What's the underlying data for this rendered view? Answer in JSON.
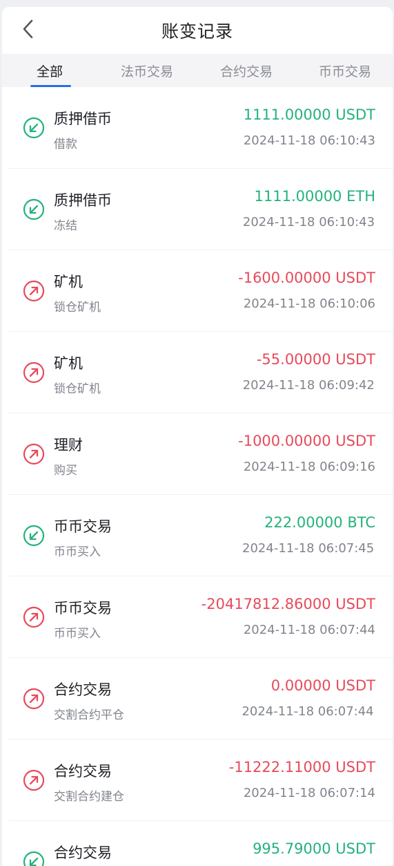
{
  "header": {
    "title": "账变记录",
    "back_icon": "chevron-left-icon"
  },
  "tabs": [
    {
      "label": "全部",
      "active": true
    },
    {
      "label": "法币交易",
      "active": false
    },
    {
      "label": "合约交易",
      "active": false
    },
    {
      "label": "币币交易",
      "active": false
    }
  ],
  "colors": {
    "positive": "#23b27b",
    "negative": "#e74a5b",
    "accent": "#2a6ee8"
  },
  "records": [
    {
      "title": "质押借币",
      "sub": "借款",
      "amount": "1111.00000 USDT",
      "time": "2024-11-18 06:10:43",
      "direction": "in",
      "icon": "arrow-down-left-icon"
    },
    {
      "title": "质押借币",
      "sub": "冻结",
      "amount": "1111.00000 ETH",
      "time": "2024-11-18 06:10:43",
      "direction": "in",
      "icon": "arrow-down-left-icon"
    },
    {
      "title": "矿机",
      "sub": "锁仓矿机",
      "amount": "-1600.00000 USDT",
      "time": "2024-11-18 06:10:06",
      "direction": "out",
      "icon": "arrow-up-right-icon"
    },
    {
      "title": "矿机",
      "sub": "锁仓矿机",
      "amount": "-55.00000 USDT",
      "time": "2024-11-18 06:09:42",
      "direction": "out",
      "icon": "arrow-up-right-icon"
    },
    {
      "title": "理财",
      "sub": "购买",
      "amount": "-1000.00000 USDT",
      "time": "2024-11-18 06:09:16",
      "direction": "out",
      "icon": "arrow-up-right-icon"
    },
    {
      "title": "币币交易",
      "sub": "币币买入",
      "amount": "222.00000 BTC",
      "time": "2024-11-18 06:07:45",
      "direction": "in",
      "icon": "arrow-down-left-icon"
    },
    {
      "title": "币币交易",
      "sub": "币币买入",
      "amount": "-20417812.86000 USDT",
      "time": "2024-11-18 06:07:44",
      "direction": "out",
      "icon": "arrow-up-right-icon"
    },
    {
      "title": "合约交易",
      "sub": "交割合约平仓",
      "amount": "0.00000 USDT",
      "time": "2024-11-18 06:07:44",
      "direction": "out",
      "icon": "arrow-up-right-icon"
    },
    {
      "title": "合约交易",
      "sub": "交割合约建仓",
      "amount": "-11222.11000 USDT",
      "time": "2024-11-18 06:07:14",
      "direction": "out",
      "icon": "arrow-up-right-icon"
    },
    {
      "title": "合约交易",
      "sub": "",
      "amount": "995.79000 USDT",
      "time": "",
      "direction": "in",
      "icon": "arrow-down-left-icon"
    }
  ]
}
